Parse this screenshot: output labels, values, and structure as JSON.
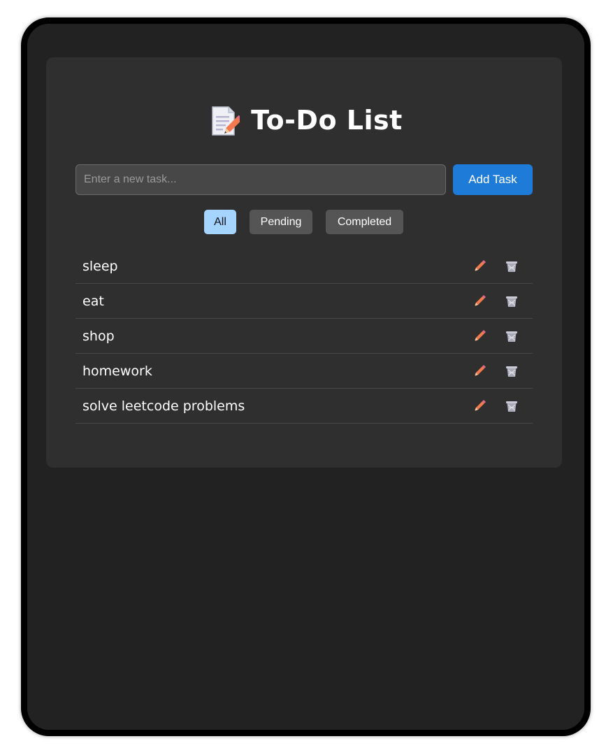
{
  "header": {
    "title": "To-Do List",
    "icon": "memo-icon"
  },
  "new_task": {
    "placeholder": "Enter a new task...",
    "value": ""
  },
  "add_button": {
    "label": "Add Task"
  },
  "filters": [
    {
      "label": "All",
      "active": true
    },
    {
      "label": "Pending",
      "active": false
    },
    {
      "label": "Completed",
      "active": false
    }
  ],
  "tasks": [
    {
      "text": "sleep"
    },
    {
      "text": "eat"
    },
    {
      "text": "shop"
    },
    {
      "text": "homework"
    },
    {
      "text": "solve leetcode problems"
    }
  ],
  "icons": {
    "edit": "pencil-icon",
    "delete": "wastebasket-icon"
  },
  "colors": {
    "background": "#222222",
    "card": "#2f2f2f",
    "accent": "#1e7bd8",
    "active_filter": "#a4d4ff",
    "filter": "#555555"
  }
}
